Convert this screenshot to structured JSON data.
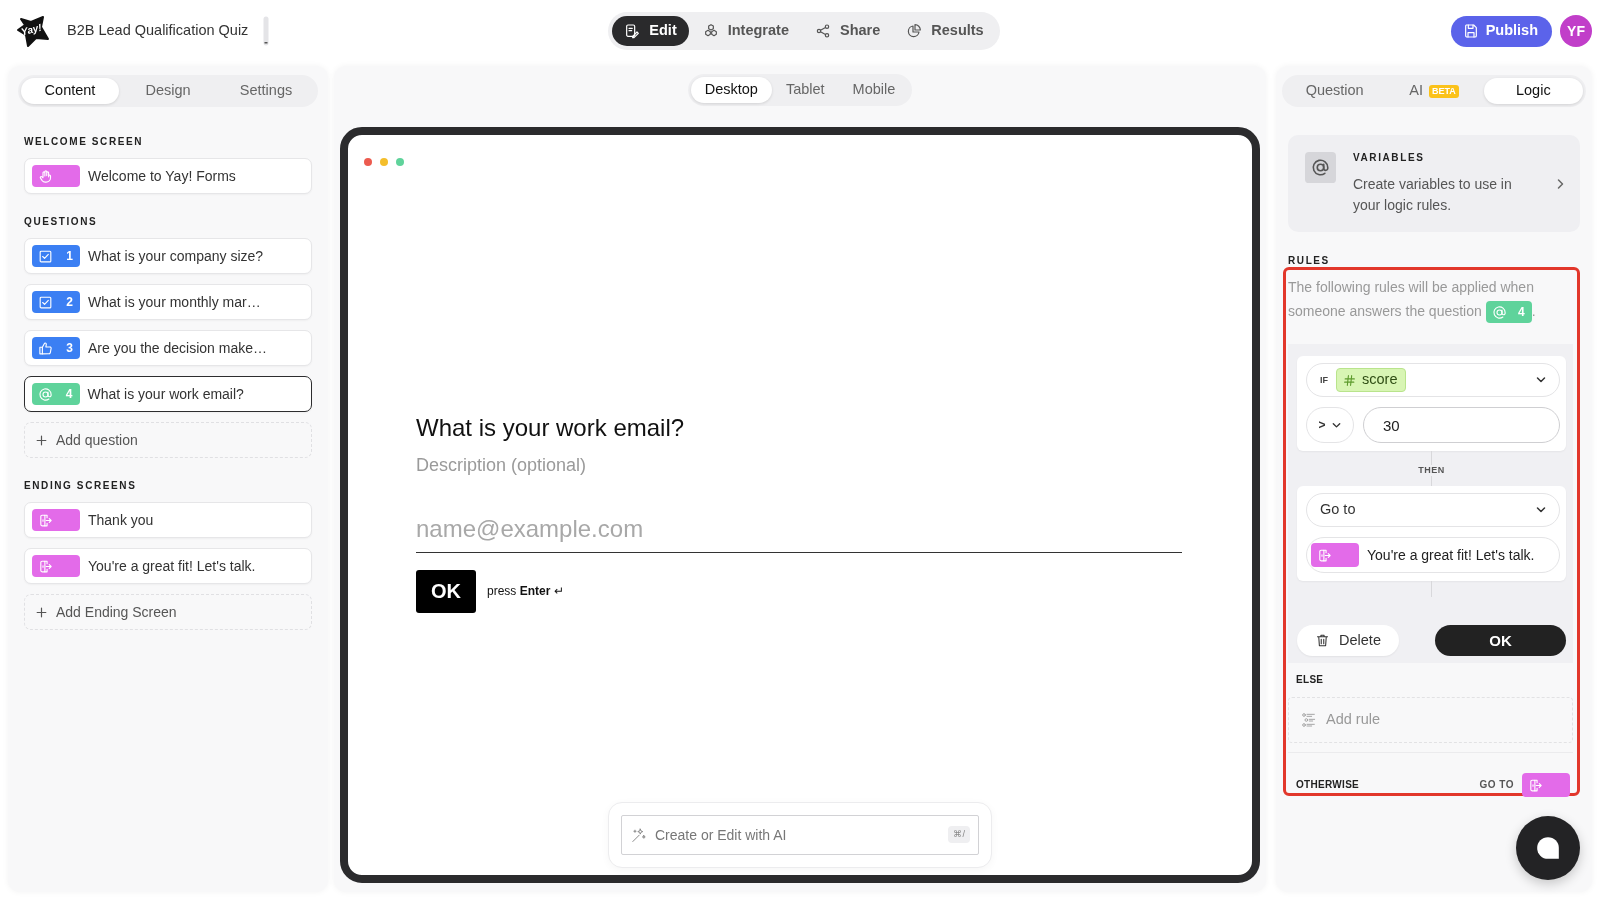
{
  "header": {
    "logo_text": "Yay!",
    "form_title": "B2B Lead Qualification Quiz",
    "mode_tabs": [
      {
        "kind": "edit",
        "label": "Edit",
        "selected": true
      },
      {
        "kind": "integrate",
        "label": "Integrate",
        "selected": false
      },
      {
        "kind": "share",
        "label": "Share",
        "selected": false
      },
      {
        "kind": "results",
        "label": "Results",
        "selected": false
      }
    ],
    "publish_button": {
      "label": "Publish"
    },
    "avatar": {
      "initials": "YF"
    }
  },
  "content_panel": {
    "tabs": [
      {
        "label": "Content",
        "selected": true
      },
      {
        "label": "Design",
        "selected": false
      },
      {
        "label": "Settings",
        "selected": false
      }
    ],
    "sections": [
      {
        "heading": "WELCOME SCREEN",
        "items": [
          {
            "kind": "welcome",
            "color": "#e36be9",
            "label": "Welcome to Yay! Forms",
            "selected": false
          }
        ]
      },
      {
        "heading": "QUESTIONS",
        "items": [
          {
            "kind": "multiple_choice",
            "color": "#3b7ff3",
            "number": "1",
            "label": "What is your company size?",
            "selected": false
          },
          {
            "kind": "multiple_choice",
            "color": "#3b7ff3",
            "number": "2",
            "label": "What is your monthly mar…",
            "selected": false
          },
          {
            "kind": "yes_no",
            "color": "#3b7ff3",
            "number": "3",
            "label": "Are you the decision make…",
            "selected": false
          },
          {
            "kind": "email",
            "color": "#5fd39b",
            "number": "4",
            "label": "What is your work email?",
            "selected": true
          }
        ],
        "add_label": "Add question"
      },
      {
        "heading": "ENDING SCREENS",
        "items": [
          {
            "kind": "ending",
            "color": "#e36be9",
            "label": "Thank you",
            "selected": false
          },
          {
            "kind": "ending",
            "color": "#e36be9",
            "label": "You're a great fit! Let's talk.",
            "selected": false
          }
        ],
        "add_label": "Add Ending Screen"
      }
    ]
  },
  "preview": {
    "device_tabs": [
      {
        "label": "Desktop",
        "selected": true
      },
      {
        "label": "Tablet",
        "selected": false
      },
      {
        "label": "Mobile",
        "selected": false
      }
    ],
    "question": {
      "title": "What is your work email?",
      "description": {
        "placeholder": "Description (optional)"
      },
      "answer": {
        "placeholder": "name@example.com"
      },
      "submit_label": "OK",
      "submit_hint": "press **Enter** ↵"
    },
    "ai_prompt": {
      "placeholder": "Create or Edit with AI",
      "shortcut": "⌘/"
    }
  },
  "settings_panel": {
    "tabs": [
      {
        "label": "Question",
        "selected": false
      },
      {
        "label": "AI",
        "badge": "BETA",
        "selected": false
      },
      {
        "label": "Logic",
        "selected": true
      }
    ],
    "variables": {
      "heading": "VARIABLES",
      "text": "Create variables to use in your logic rules."
    },
    "rules": {
      "heading": "RULES",
      "highlighted": true,
      "intro": "The following rules will be applied when someone answers the question",
      "question_tag": {
        "kind": "email",
        "number": "4",
        "color": "#5fd39b"
      },
      "intro_end": ".",
      "rule": {
        "if_label": "IF",
        "variable": "score",
        "operator": ">",
        "value": "30",
        "then_label": "THEN",
        "action": "Go to",
        "target": {
          "kind": "ending",
          "color": "#e36be9",
          "label": "You're a great fit! Let's talk."
        },
        "delete_label": "Delete",
        "ok_label": "OK"
      },
      "else": {
        "heading": "ELSE",
        "add_label": "Add rule"
      },
      "otherwise": {
        "heading": "OTHERWISE",
        "goto_label": "GO TO",
        "target": {
          "kind": "ending",
          "color": "#e36be9"
        }
      }
    }
  }
}
